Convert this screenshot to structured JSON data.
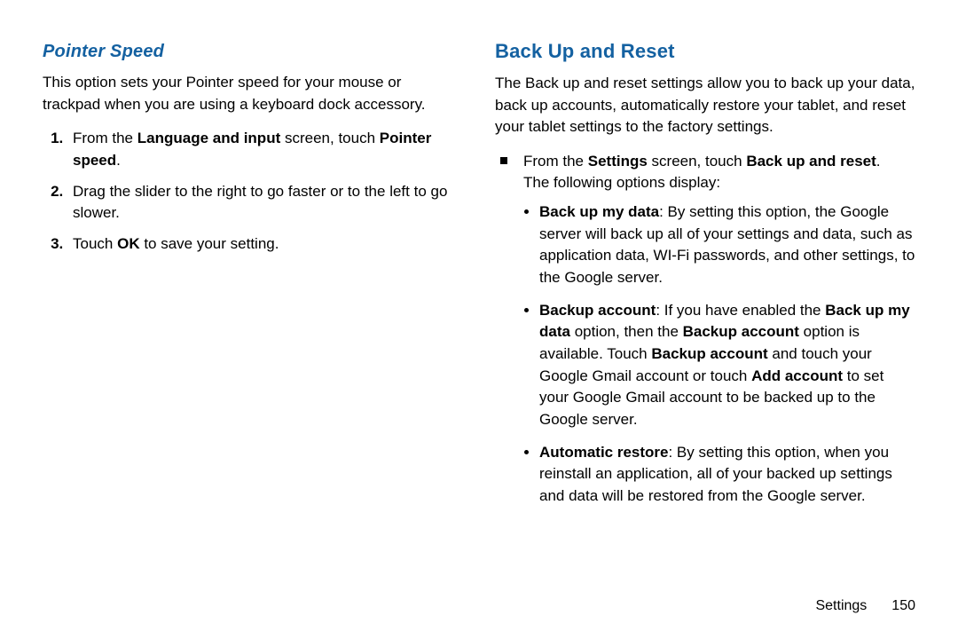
{
  "left": {
    "heading": "Pointer Speed",
    "intro": "This option sets your Pointer speed for your mouse or trackpad when you are using a keyboard dock accessory.",
    "step1_pre": "From the ",
    "step1_bold1": "Language and input",
    "step1_mid": " screen, touch ",
    "step1_bold2": "Pointer speed",
    "step1_post": ".",
    "step2": "Drag the slider to the right to go faster or to the left to go slower.",
    "step3_pre": "Touch ",
    "step3_bold": "OK",
    "step3_post": " to save your setting."
  },
  "right": {
    "heading": "Back Up and Reset",
    "intro": "The Back up and reset settings allow you to back up your data, back up accounts, automatically restore your tablet, and reset your tablet settings to the factory settings.",
    "line1_pre": "From the ",
    "line1_bold1": "Settings",
    "line1_mid": " screen, touch ",
    "line1_bold2": "Back up and reset",
    "line1_post": ".",
    "line2": "The following options display:",
    "b1_bold": "Back up my data",
    "b1_text": ": By setting this option, the Google server will back up all of your settings and data, such as application data, WI-Fi passwords, and other settings, to the Google server.",
    "b2_bold1": "Backup account",
    "b2_t1": ": If you have enabled the ",
    "b2_bold2": "Back up my data",
    "b2_t2": " option, then the ",
    "b2_bold3": "Backup account",
    "b2_t3": " option is available. Touch ",
    "b2_bold4": "Backup account",
    "b2_t4": " and touch your Google Gmail account or touch ",
    "b2_bold5": "Add account",
    "b2_t5": " to set your Google Gmail account to be backed up to the Google server.",
    "b3_bold": "Automatic restore",
    "b3_text": ": By setting this option, when you reinstall an application, all of your backed up settings and data will be restored from the Google server."
  },
  "footer": {
    "section": "Settings",
    "page": "150"
  }
}
